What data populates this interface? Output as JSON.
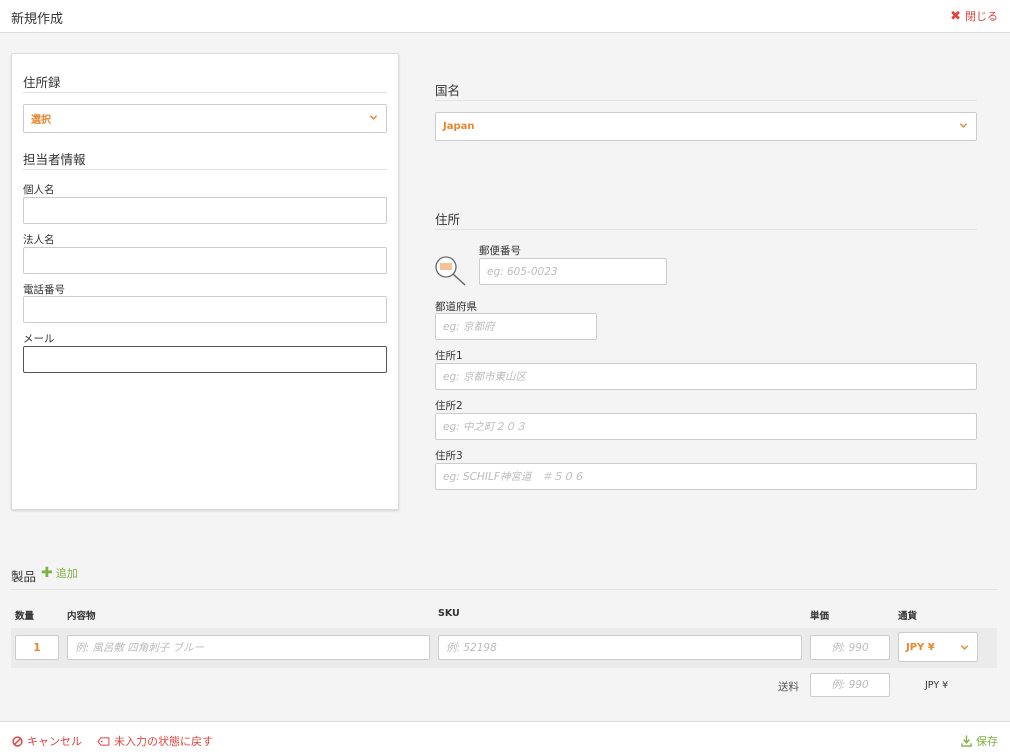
{
  "header": {
    "title": "新規作成",
    "close_label": "閉じる"
  },
  "contact": {
    "address_book": {
      "title": "住所録",
      "select_value": "選択"
    },
    "person_info_title": "担当者情報",
    "fields": [
      {
        "label": "個人名",
        "value": ""
      },
      {
        "label": "法人名",
        "value": ""
      },
      {
        "label": "電話番号",
        "value": ""
      },
      {
        "label": "メール",
        "value": ""
      }
    ]
  },
  "country": {
    "title": "国名",
    "select_value": "Japan"
  },
  "address": {
    "title": "住所",
    "postal": {
      "label": "郵便番号",
      "placeholder": "eg: 605-0023"
    },
    "prefecture": {
      "label": "都道府県",
      "placeholder": "eg: 京都府"
    },
    "line1": {
      "label": "住所1",
      "placeholder": "eg: 京都市東山区"
    },
    "line2": {
      "label": "住所2",
      "placeholder": "eg: 中之町２０３"
    },
    "line3": {
      "label": "住所3",
      "placeholder": "eg: SCHILF神宮道　＃５０６"
    }
  },
  "products": {
    "title": "製品",
    "add_label": "追加",
    "columns": {
      "qty": "数量",
      "content": "内容物",
      "sku": "SKU",
      "price": "単価",
      "currency": "通貨"
    },
    "row": {
      "qty": "1",
      "content_placeholder": "例: 風呂敷 四角刺子 ブルー",
      "sku_placeholder": "例: 52198",
      "price_placeholder": "例: 990",
      "currency": "JPY ¥"
    },
    "shipping": {
      "label": "送料",
      "placeholder": "例: 990",
      "currency": "JPY ¥"
    }
  },
  "footer": {
    "cancel_label": "キャンセル",
    "reset_label": "未入力の状態に戻す",
    "save_label": "保存"
  },
  "colors": {
    "accent": "#e8862e",
    "danger": "#e0443e",
    "success": "#7cb342"
  }
}
